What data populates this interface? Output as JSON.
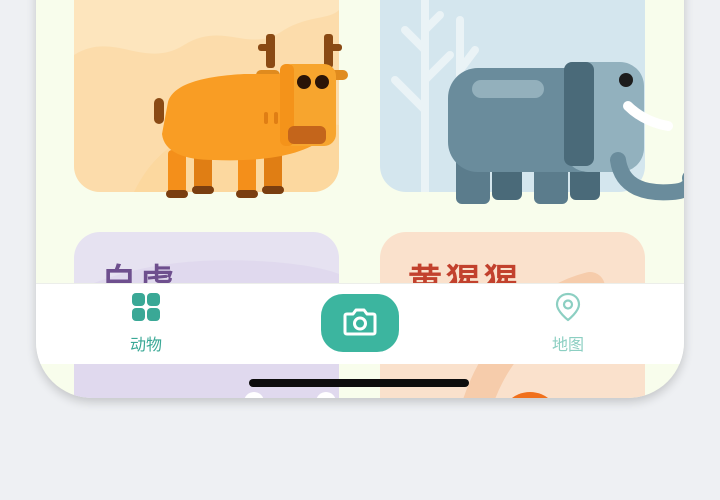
{
  "cards": [
    {
      "id": "ox",
      "title": ""
    },
    {
      "id": "elephant",
      "title": ""
    },
    {
      "id": "tiger",
      "title": "白虎"
    },
    {
      "id": "gibbon",
      "title": "黄猩猩"
    }
  ],
  "tabbar": {
    "animals_label": "动物",
    "animals_icon": "grid-icon",
    "camera_icon": "camera-icon",
    "map_label": "地图",
    "map_icon": "location-pin-icon"
  },
  "colors": {
    "accent": "#3cb59f",
    "ox_card": "#fde5bd",
    "elephant_card": "#d4e6ee",
    "tiger_card": "#e6e2f1",
    "gibbon_card": "#fae1cc"
  }
}
